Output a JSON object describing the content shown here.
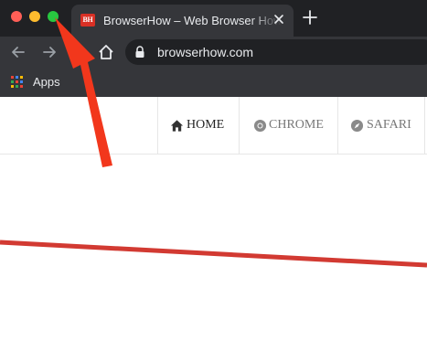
{
  "window": {
    "controls": [
      "close-button",
      "minimize-button",
      "maximize-button"
    ]
  },
  "tab": {
    "favicon_text": "BH",
    "title": "BrowserHow – Web Browser How-To",
    "close_icon": "close-icon"
  },
  "toolbar": {
    "url": "browserhow.com",
    "lock_icon": "lock-icon"
  },
  "bookmarks": {
    "apps_label": "Apps"
  },
  "site_nav": {
    "items": [
      {
        "label": "HOME",
        "icon": "home-icon"
      },
      {
        "label": "CHROME",
        "icon": "chrome-icon"
      },
      {
        "label": "SAFARI",
        "icon": "compass-icon"
      }
    ]
  },
  "colors": {
    "tab_bar": "#202124",
    "toolbar": "#35363a",
    "arrow": "#f2371c",
    "underline": "#d23a32",
    "traffic_close": "#ff5f57",
    "traffic_min": "#febc2e",
    "traffic_max": "#28c840"
  }
}
